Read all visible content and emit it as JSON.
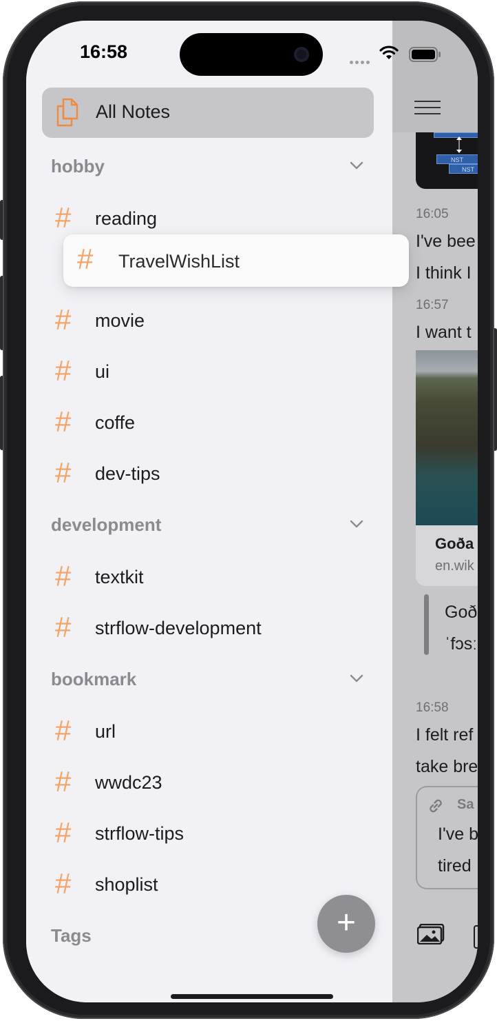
{
  "status_bar": {
    "time": "16:58"
  },
  "sidebar": {
    "all_notes": "All Notes",
    "sections": [
      {
        "title": "hobby",
        "tags": [
          "reading",
          "movie",
          "ui",
          "coffe",
          "dev-tips"
        ]
      },
      {
        "title": "development",
        "tags": [
          "textkit",
          "strflow-development"
        ]
      },
      {
        "title": "bookmark",
        "tags": [
          "url",
          "wwdc23",
          "strflow-tips",
          "shoplist"
        ]
      }
    ],
    "dragging_tag": "TravelWishList",
    "tags_section_title": "Tags",
    "fab_label": "+"
  },
  "note_pane": {
    "diagram_labels": [
      "NST",
      "NST"
    ],
    "entries": [
      {
        "time": "16:05",
        "lines": [
          "I've bee",
          "I think I"
        ]
      },
      {
        "time": "16:57",
        "lines": [
          "I want t"
        ]
      },
      {
        "time": "16:58",
        "lines": [
          "I felt ref",
          "take bre"
        ]
      }
    ],
    "link_preview": {
      "title": "Goða",
      "domain": "en.wik"
    },
    "quote_lines": [
      "Goð",
      "ˈfɔsː"
    ],
    "link_card": {
      "label": "Sa",
      "lines": [
        "I've b",
        "tired"
      ]
    }
  },
  "colors": {
    "accent": "#f4a466",
    "sidebar_bg": "#f2f1f6",
    "selected_bg": "#c6c5ca"
  }
}
